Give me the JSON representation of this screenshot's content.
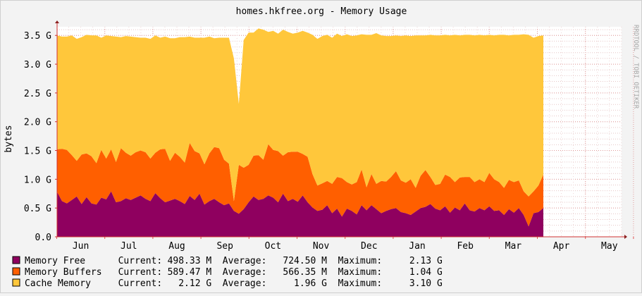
{
  "chart_data": {
    "type": "area",
    "title": "homes.hkfree.org - Memory Usage",
    "ylabel": "bytes",
    "watermark": "RRDTOOL / TOBI OETIKER",
    "yticks": [
      "0.0",
      "0.5 G",
      "1.0 G",
      "1.5 G",
      "2.0 G",
      "2.5 G",
      "3.0 G",
      "3.5 G"
    ],
    "ylim": [
      0,
      3.65
    ],
    "xticks": [
      "Jun",
      "Jul",
      "Aug",
      "Sep",
      "Oct",
      "Nov",
      "Dec",
      "Jan",
      "Feb",
      "Mar",
      "Apr",
      "May",
      "Jun"
    ],
    "stacked": true,
    "series": [
      {
        "name": "Memory Free",
        "color": "#8f005f",
        "values": [
          0.78,
          0.62,
          0.58,
          0.64,
          0.7,
          0.57,
          0.69,
          0.58,
          0.56,
          0.68,
          0.65,
          0.79,
          0.6,
          0.62,
          0.67,
          0.64,
          0.68,
          0.72,
          0.66,
          0.62,
          0.76,
          0.67,
          0.6,
          0.63,
          0.66,
          0.62,
          0.57,
          0.71,
          0.64,
          0.75,
          0.56,
          0.62,
          0.66,
          0.6,
          0.55,
          0.58,
          0.45,
          0.4,
          0.48,
          0.6,
          0.7,
          0.64,
          0.66,
          0.72,
          0.68,
          0.6,
          0.75,
          0.62,
          0.66,
          0.61,
          0.72,
          0.6,
          0.51,
          0.45,
          0.47,
          0.55,
          0.41,
          0.49,
          0.35,
          0.49,
          0.45,
          0.39,
          0.55,
          0.46,
          0.55,
          0.48,
          0.41,
          0.45,
          0.48,
          0.5,
          0.43,
          0.41,
          0.38,
          0.44,
          0.5,
          0.52,
          0.57,
          0.49,
          0.46,
          0.53,
          0.42,
          0.51,
          0.46,
          0.58,
          0.46,
          0.44,
          0.5,
          0.46,
          0.53,
          0.45,
          0.46,
          0.38,
          0.48,
          0.42,
          0.5,
          0.38,
          0.18,
          0.41,
          0.43,
          0.5
        ]
      },
      {
        "name": "Memory Buffers",
        "color": "#ff5f00",
        "values": [
          0.74,
          0.91,
          0.93,
          0.78,
          0.62,
          0.86,
          0.76,
          0.82,
          0.72,
          0.83,
          0.71,
          0.73,
          0.7,
          0.92,
          0.79,
          0.77,
          0.79,
          0.78,
          0.81,
          0.74,
          0.7,
          0.85,
          0.93,
          0.69,
          0.8,
          0.77,
          0.72,
          0.92,
          0.85,
          0.7,
          0.7,
          0.83,
          0.9,
          0.94,
          0.79,
          0.69,
          0.17,
          0.85,
          0.72,
          0.65,
          0.71,
          0.78,
          0.68,
          0.89,
          0.83,
          0.89,
          0.66,
          0.85,
          0.82,
          0.87,
          0.72,
          0.79,
          0.58,
          0.44,
          0.46,
          0.42,
          0.51,
          0.55,
          0.67,
          0.46,
          0.46,
          0.56,
          0.62,
          0.4,
          0.54,
          0.44,
          0.56,
          0.51,
          0.56,
          0.64,
          0.55,
          0.53,
          0.62,
          0.41,
          0.56,
          0.64,
          0.47,
          0.41,
          0.46,
          0.55,
          0.62,
          0.44,
          0.57,
          0.46,
          0.58,
          0.51,
          0.5,
          0.49,
          0.58,
          0.55,
          0.49,
          0.47,
          0.51,
          0.53,
          0.48,
          0.41,
          0.52,
          0.38,
          0.46,
          0.58
        ]
      },
      {
        "name": "Cache Memory",
        "color": "#ffc73b",
        "values": [
          1.98,
          1.95,
          1.97,
          2.08,
          2.12,
          2.04,
          2.06,
          2.1,
          2.22,
          1.95,
          2.14,
          1.97,
          2.18,
          1.93,
          2.03,
          2.07,
          2.0,
          1.96,
          1.99,
          2.08,
          2.04,
          1.94,
          1.95,
          2.13,
          1.99,
          2.08,
          2.18,
          1.85,
          1.97,
          2.01,
          2.2,
          2.03,
          1.89,
          1.92,
          2.12,
          2.19,
          2.48,
          1.06,
          2.22,
          2.3,
          2.14,
          2.2,
          2.26,
          1.95,
          2.07,
          2.04,
          2.19,
          2.09,
          2.05,
          2.07,
          2.14,
          2.16,
          2.42,
          2.55,
          2.56,
          2.54,
          2.54,
          2.49,
          2.47,
          2.57,
          2.58,
          2.55,
          2.35,
          2.65,
          2.42,
          2.62,
          2.53,
          2.53,
          2.45,
          2.36,
          2.51,
          2.56,
          2.49,
          2.65,
          2.44,
          2.34,
          2.47,
          2.6,
          2.58,
          2.43,
          2.46,
          2.56,
          2.47,
          2.47,
          2.47,
          2.55,
          2.51,
          2.55,
          2.4,
          2.5,
          2.56,
          2.66,
          2.51,
          2.56,
          2.53,
          2.73,
          2.81,
          2.67,
          2.6,
          2.42
        ]
      }
    ],
    "legend": [
      {
        "name": "Memory Free",
        "current_label": "Current:",
        "current": "498.33 M",
        "average_label": "Average:",
        "average": "724.50 M",
        "maximum_label": "Maximum:",
        "maximum": "2.13 G"
      },
      {
        "name": "Memory Buffers",
        "current_label": "Current:",
        "current": "589.47 M",
        "average_label": "Average:",
        "average": "566.35 M",
        "maximum_label": "Maximum:",
        "maximum": "1.04 G"
      },
      {
        "name": "Cache Memory",
        "current_label": "Current:",
        "current": "2.12 G",
        "average_label": "Average:",
        "average": "1.96 G",
        "maximum_label": "Maximum:",
        "maximum": "3.10 G"
      }
    ]
  }
}
